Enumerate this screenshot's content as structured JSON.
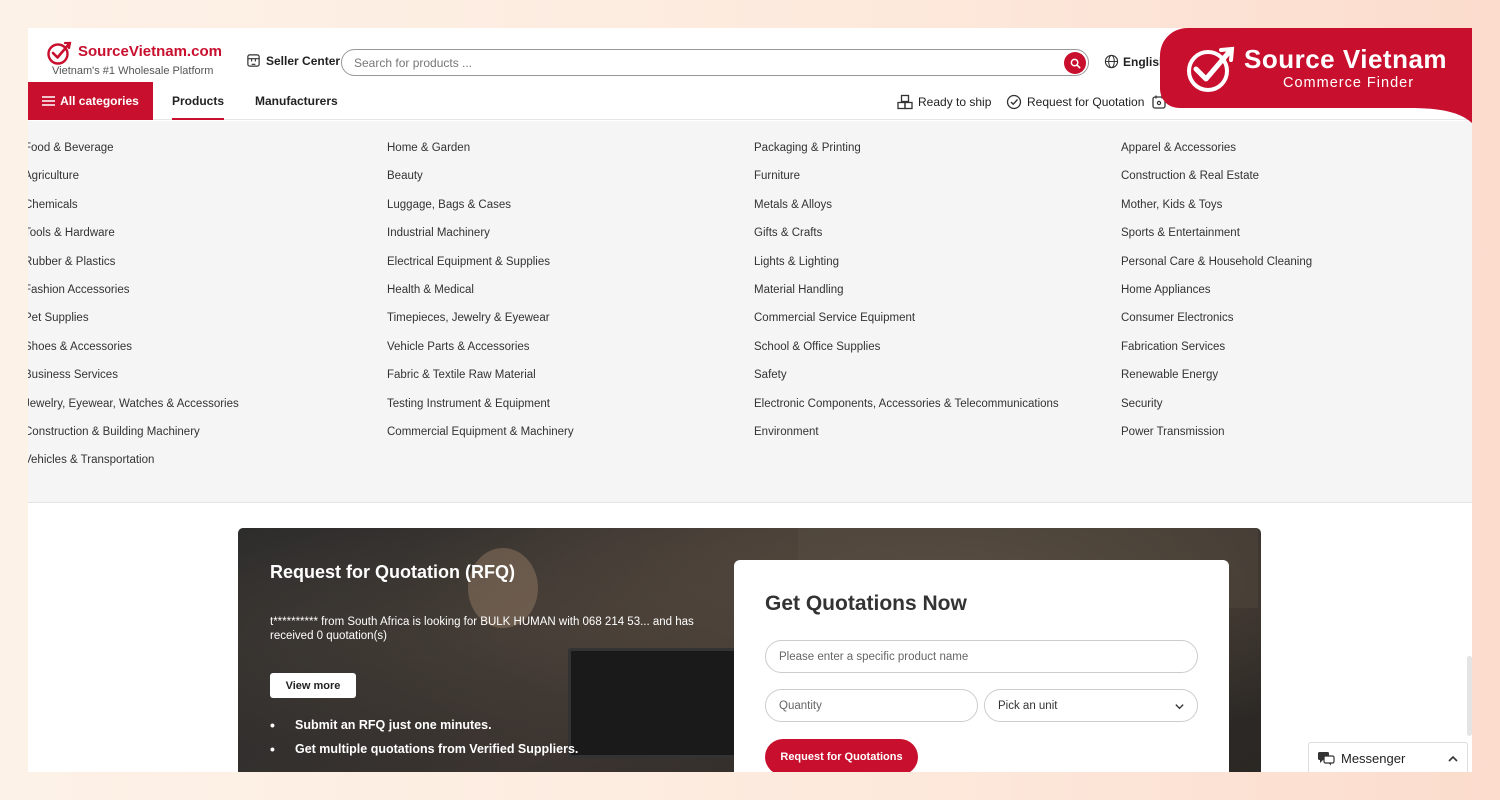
{
  "header": {
    "logo_text": "SourceVietnam.com",
    "logo_tagline": "Vietnam's #1 Wholesale Platform",
    "seller_center": "Seller Center",
    "search_placeholder": "Search for products ...",
    "language": "English"
  },
  "nav": {
    "all_categories": "All categories",
    "products": "Products",
    "manufacturers": "Manufacturers",
    "ready_to_ship": "Ready to ship",
    "request_for_quotation": "Request for Quotation"
  },
  "categories": {
    "col1": [
      "Food & Beverage",
      "Agriculture",
      "Chemicals",
      "Tools & Hardware",
      "Rubber & Plastics",
      "Fashion Accessories",
      "Pet Supplies",
      "Shoes & Accessories",
      "Business Services",
      "Jewelry, Eyewear, Watches & Accessories",
      "Construction & Building Machinery",
      "Vehicles & Transportation"
    ],
    "col2": [
      "Home & Garden",
      "Beauty",
      "Luggage, Bags & Cases",
      "Industrial Machinery",
      "Electrical Equipment & Supplies",
      "Health & Medical",
      "Timepieces, Jewelry & Eyewear",
      "Vehicle Parts & Accessories",
      "Fabric & Textile Raw Material",
      "Testing Instrument & Equipment",
      "Commercial Equipment & Machinery"
    ],
    "col3": [
      "Packaging & Printing",
      "Furniture",
      "Metals & Alloys",
      "Gifts & Crafts",
      "Lights & Lighting",
      "Material Handling",
      "Commercial Service Equipment",
      "School & Office Supplies",
      "Safety",
      "Electronic Components, Accessories & Telecommunications",
      "Environment"
    ],
    "col4": [
      "Apparel & Accessories",
      "Construction & Real Estate",
      "Mother, Kids & Toys",
      "Sports & Entertainment",
      "Personal Care & Household Cleaning",
      "Home Appliances",
      "Consumer Electronics",
      "Fabrication Services",
      "Renewable Energy",
      "Security",
      "Power Transmission"
    ]
  },
  "rfq": {
    "title": "Request for Quotation (RFQ)",
    "description": "t********** from South Africa is looking for BULK HUMAN with 068 214 53... and has received 0 quotation(s)",
    "view_more": "View more",
    "bullets": [
      "Submit an RFQ just one minutes.",
      "Get multiple quotations from Verified Suppliers."
    ]
  },
  "quote_form": {
    "title": "Get Quotations Now",
    "product_placeholder": "Please enter a specific product name",
    "quantity_placeholder": "Quantity",
    "unit_selected": "Pick an unit",
    "submit": "Request for Quotations"
  },
  "messenger": {
    "label": "Messenger"
  },
  "brand": {
    "title": "Source Vietnam",
    "subtitle": "Commerce Finder",
    "color": "#c8102e"
  },
  "colors": {
    "accent": "#c8102e",
    "dropdown_bg": "#f5f5f5"
  }
}
